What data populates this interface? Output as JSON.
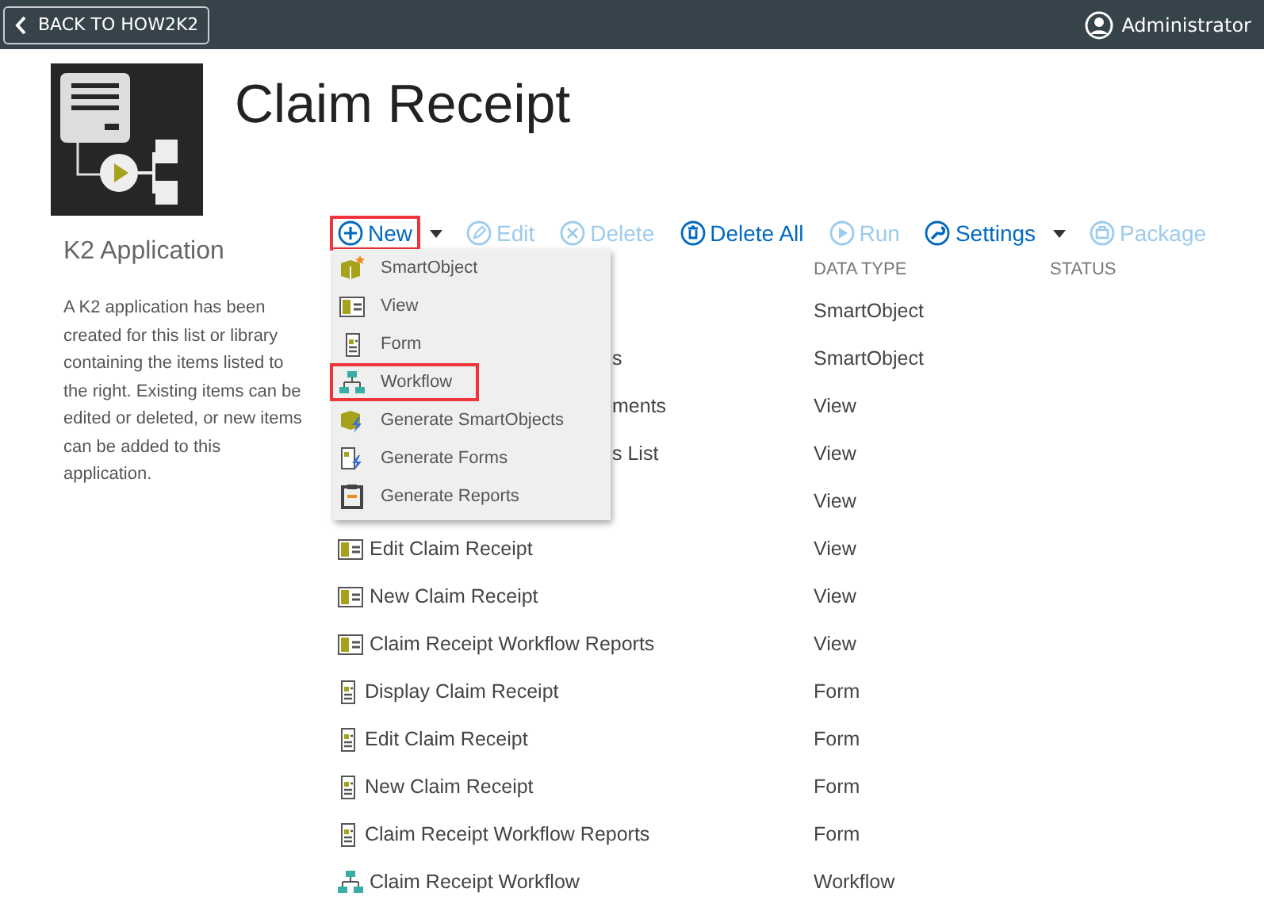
{
  "top_bar": {
    "back_button": "BACK TO HOW2K2",
    "user": "Administrator"
  },
  "title": "Claim Receipt",
  "sidebar": {
    "heading": "K2 Application",
    "description": "A K2 application has been created for this list or library containing the items listed to the right. Existing items can be edited or deleted, or new items can be added to this application."
  },
  "toolbar": [
    {
      "kind": "new",
      "label": "New",
      "disabled": false,
      "highlighted": true,
      "dropdown": true
    },
    {
      "kind": "edit",
      "label": "Edit",
      "disabled": true,
      "highlighted": false,
      "dropdown": false
    },
    {
      "kind": "delete",
      "label": "Delete",
      "disabled": true,
      "highlighted": false,
      "dropdown": false
    },
    {
      "kind": "delete-all",
      "label": "Delete All",
      "disabled": false,
      "highlighted": false,
      "dropdown": false
    },
    {
      "kind": "run",
      "label": "Run",
      "disabled": true,
      "highlighted": false,
      "dropdown": false
    },
    {
      "kind": "settings",
      "label": "Settings",
      "disabled": false,
      "highlighted": false,
      "dropdown": true
    },
    {
      "kind": "package",
      "label": "Package",
      "disabled": true,
      "highlighted": false,
      "dropdown": false
    }
  ],
  "new_menu": [
    {
      "kind": "smartobject",
      "label": "SmartObject",
      "highlighted": false
    },
    {
      "kind": "view",
      "label": "View",
      "highlighted": false
    },
    {
      "kind": "form",
      "label": "Form",
      "highlighted": false
    },
    {
      "kind": "workflow",
      "label": "Workflow",
      "highlighted": true
    },
    {
      "kind": "generate-smartobjects",
      "label": "Generate SmartObjects",
      "highlighted": false
    },
    {
      "kind": "generate-forms",
      "label": "Generate Forms",
      "highlighted": false
    },
    {
      "kind": "generate-reports",
      "label": "Generate Reports",
      "highlighted": false
    }
  ],
  "table": {
    "columns": [
      "DATA TYPE",
      "STATUS"
    ],
    "rows": [
      {
        "data_type": "SmartObject"
      },
      {
        "name": "s",
        "covered": true,
        "data_type": "SmartObject"
      },
      {
        "name": "ments",
        "covered": true,
        "data_type": "View"
      },
      {
        "name": "s List",
        "covered": true,
        "data_type": "View"
      },
      {
        "data_type": "View"
      },
      {
        "kind": "view",
        "name": "Edit Claim Receipt",
        "covered": false,
        "data_type": "View"
      },
      {
        "kind": "view",
        "name": "New Claim Receipt",
        "covered": false,
        "data_type": "View"
      },
      {
        "kind": "view",
        "name": "Claim Receipt Workflow Reports",
        "covered": false,
        "data_type": "View"
      },
      {
        "kind": "form",
        "name": "Display Claim Receipt",
        "covered": false,
        "data_type": "Form"
      },
      {
        "kind": "form",
        "name": "Edit Claim Receipt",
        "covered": false,
        "data_type": "Form"
      },
      {
        "kind": "form",
        "name": "New Claim Receipt",
        "covered": false,
        "data_type": "Form"
      },
      {
        "kind": "form",
        "name": "Claim Receipt Workflow Reports",
        "covered": false,
        "data_type": "Form"
      },
      {
        "kind": "workflow",
        "name": "Claim Receipt Workflow",
        "covered": false,
        "data_type": "Workflow"
      }
    ]
  }
}
